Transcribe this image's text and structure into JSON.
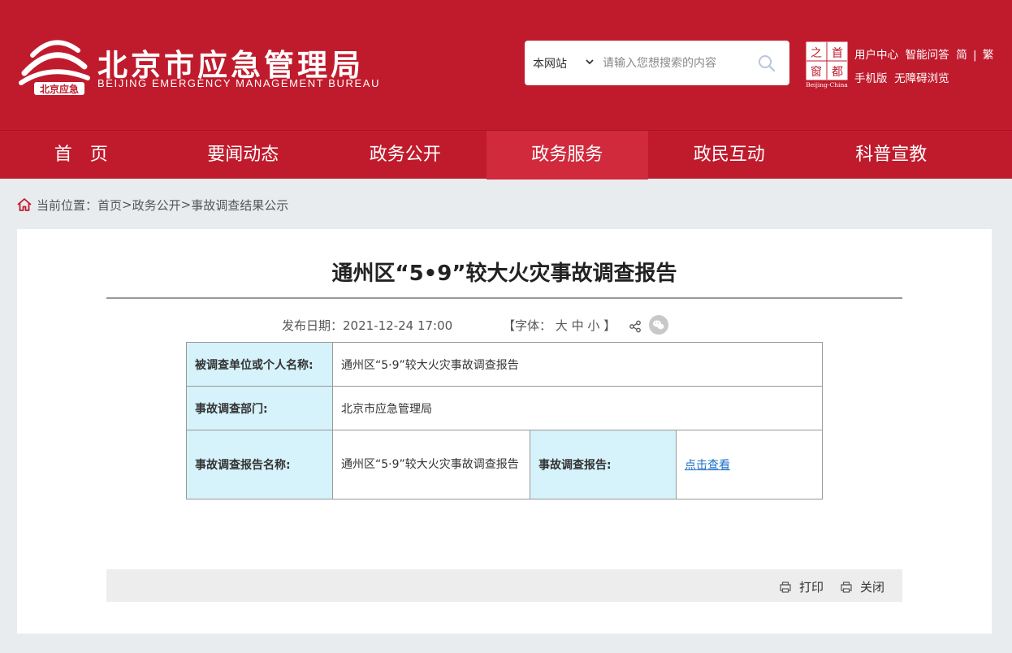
{
  "header": {
    "logo_cn": "北京市应急管理局",
    "logo_en": "BEIJING EMERGENCY MANAGEMENT BUREAU",
    "logo_mark_text": "北京应急",
    "search": {
      "scope": "本网站",
      "placeholder": "请输入您想搜索的内容"
    },
    "capital_badge": {
      "chars": [
        "之",
        "首",
        "窗",
        "都"
      ],
      "caption": "Beijing-China"
    },
    "links_row1": [
      "用户中心",
      "智能问答",
      "简",
      "繁"
    ],
    "links_row2": [
      "手机版",
      "无障碍浏览"
    ]
  },
  "nav": {
    "items": [
      "首　页",
      "要闻动态",
      "政务公开",
      "政务服务",
      "政民互动",
      "科普宣教"
    ],
    "active_index": 3
  },
  "breadcrumb": {
    "prefix": "当前位置：",
    "items": [
      "首页",
      "政务公开",
      "事故调查结果公示"
    ],
    "separator": ">"
  },
  "article": {
    "title": "通州区“5•9”较大火灾事故调查报告",
    "publish_label": "发布日期：",
    "publish_date": "2021-12-24 17:00",
    "font_open": "【字体：",
    "font_sizes": [
      "大",
      "中",
      "小"
    ],
    "font_close": "】",
    "table": {
      "row1": {
        "label": "被调查单位或个人名称:",
        "value": "通州区“5·9”较大火灾事故调查报告"
      },
      "row2": {
        "label": "事故调查部门:",
        "value": "北京市应急管理局"
      },
      "row3": {
        "label": "事故调查报告名称:",
        "value": "通州区“5·9”较大火灾事故调查报告",
        "label2": "事故调查报告:",
        "link": "点击查看"
      }
    }
  },
  "footer": {
    "print": "打印",
    "close": "关闭"
  },
  "colors": {
    "brand_red": "#c01b2d",
    "nav_active": "#d02a3c",
    "table_label_bg": "#d6f2fb",
    "link": "#1a6fc4"
  }
}
